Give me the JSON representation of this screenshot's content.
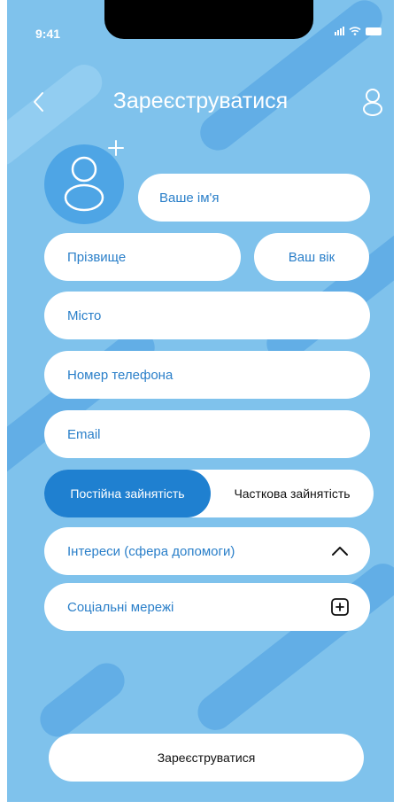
{
  "status_bar": {
    "time": "9:41"
  },
  "header": {
    "title": "Зареєструватися"
  },
  "form": {
    "first_name_placeholder": "Ваше ім'я",
    "last_name_placeholder": "Прізвище",
    "age_placeholder": "Ваш вік",
    "city_placeholder": "Місто",
    "phone_placeholder": "Номер телефона",
    "email_placeholder": "Email",
    "employment": {
      "options": [
        "Постійна зайнятість",
        "Часткова зайнятість"
      ],
      "selected": "Постійна зайнятість"
    },
    "interests_label": "Інтереси (сфера допомоги)",
    "social_label": "Соціальні мережі"
  },
  "submit_label": "Зареєструватися",
  "colors": {
    "background": "#7fc2ec",
    "accent": "#1f80d0",
    "text_accent": "#2a7fc9"
  }
}
